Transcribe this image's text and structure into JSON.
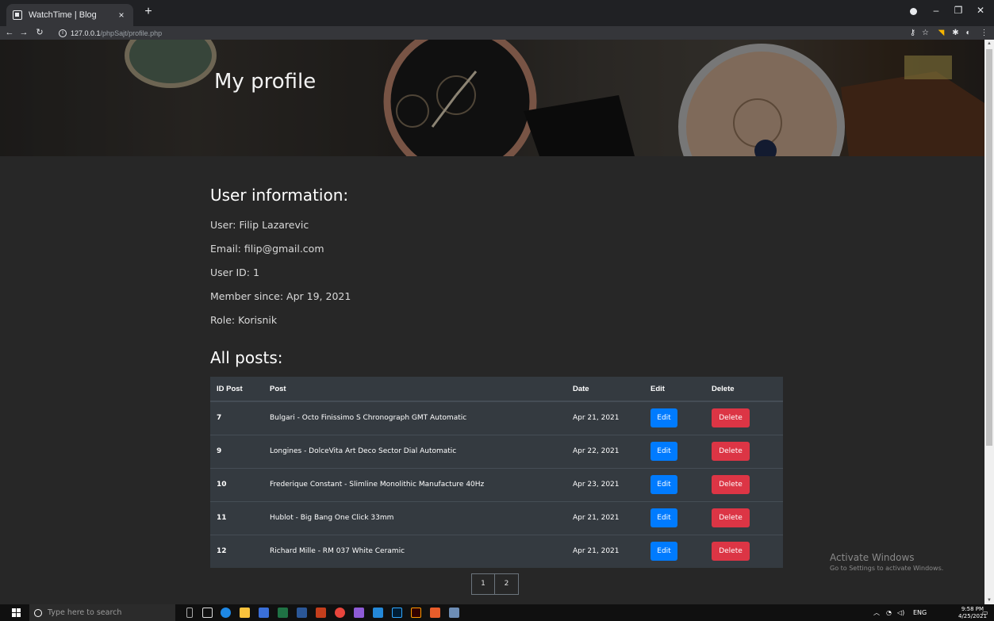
{
  "browser": {
    "tab_title": "WatchTime | Blog",
    "tab_close": "×",
    "new_tab": "+",
    "url_host": "127.0.0.1",
    "url_path": "/phpSajt/profile.php",
    "info_glyph": "i"
  },
  "hero": {
    "title": "My profile"
  },
  "user_info": {
    "heading": "User information:",
    "user": "User: Filip Lazarevic",
    "email": "Email: filip@gmail.com",
    "user_id": "User ID: 1",
    "member_since": "Member since: Apr 19, 2021",
    "role": "Role: Korisnik"
  },
  "posts": {
    "heading": "All posts:",
    "columns": [
      "ID Post",
      "Post",
      "Date",
      "Edit",
      "Delete"
    ],
    "edit_label": "Edit",
    "delete_label": "Delete",
    "rows": [
      {
        "id": "7",
        "post": "Bulgari - Octo Finissimo S Chronograph GMT Automatic",
        "date": "Apr 21, 2021"
      },
      {
        "id": "9",
        "post": "Longines - DolceVita Art Deco Sector Dial Automatic",
        "date": "Apr 22, 2021"
      },
      {
        "id": "10",
        "post": "Frederique Constant - Slimline Monolithic Manufacture 40Hz",
        "date": "Apr 23, 2021"
      },
      {
        "id": "11",
        "post": "Hublot - Big Bang One Click 33mm",
        "date": "Apr 21, 2021"
      },
      {
        "id": "12",
        "post": "Richard Mille - RM 037 White Ceramic",
        "date": "Apr 21, 2021"
      }
    ]
  },
  "pagination": {
    "pages": [
      "1",
      "2"
    ]
  },
  "activation": {
    "title": "Activate Windows",
    "subtitle": "Go to Settings to activate Windows."
  },
  "taskbar": {
    "search_placeholder": "Type here to search",
    "lang": "ENG",
    "time": "9:58 PM",
    "date": "4/25/2021"
  },
  "colors": {
    "edit_button": "#007bff",
    "delete_button": "#dc3545",
    "table_bg": "#343a40",
    "page_bg": "#272727"
  }
}
